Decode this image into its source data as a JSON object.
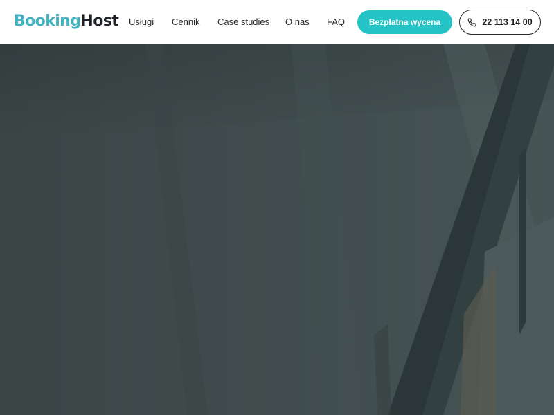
{
  "brand": {
    "name_part1": "Booking",
    "name_part2": "Host",
    "color_primary": "#3eb3bf",
    "color_dark": "#1e2226"
  },
  "nav": {
    "items": [
      {
        "label": "Usługi"
      },
      {
        "label": "Cennik"
      },
      {
        "label": "Case studies"
      },
      {
        "label": "O nas"
      },
      {
        "label": "FAQ"
      }
    ]
  },
  "header": {
    "cta_label": "Bezpłatna wycena",
    "cta_color": "#23c3c6",
    "phone_number": "22 113 14 00",
    "phone_icon": "phone-icon"
  },
  "hero": {
    "background_color": "#3f4b4c",
    "image": "dark-interior-photo"
  }
}
